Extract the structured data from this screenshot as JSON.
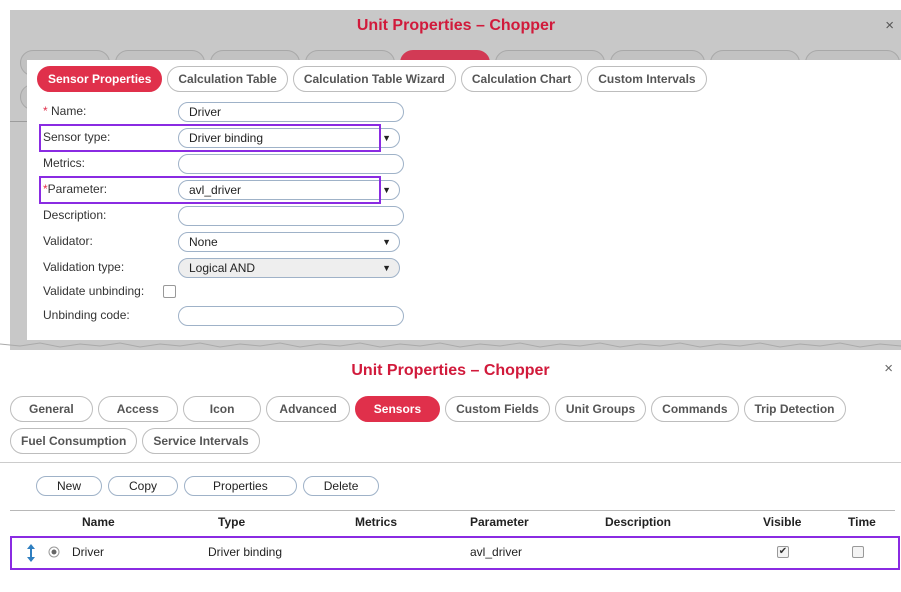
{
  "top_dialog": {
    "title": "Unit Properties – Chopper",
    "close_glyph": "×",
    "tabs": [
      "Sensor Properties",
      "Calculation Table",
      "Calculation Table Wizard",
      "Calculation Chart",
      "Custom Intervals"
    ],
    "form": {
      "name_label": "Name:",
      "name_value": "Driver",
      "sensor_type_label": "Sensor type:",
      "sensor_type_value": "Driver binding",
      "metrics_label": "Metrics:",
      "metrics_value": "",
      "parameter_label": "Parameter:",
      "parameter_value": "avl_driver",
      "description_label": "Description:",
      "description_value": "",
      "validator_label": "Validator:",
      "validator_value": "None",
      "validation_type_label": "Validation type:",
      "validation_type_value": "Logical AND",
      "validate_unbinding_label": "Validate unbinding:",
      "unbinding_code_label": "Unbinding code:",
      "unbinding_code_value": "",
      "required_mark": "*",
      "dropdown_caret": "▼"
    }
  },
  "bottom_dialog": {
    "title": "Unit Properties – Chopper",
    "close_glyph": "×",
    "tabs_row1": [
      "General",
      "Access",
      "Icon",
      "Advanced",
      "Sensors",
      "Custom Fields",
      "Unit Groups",
      "Commands",
      "Trip Detection"
    ],
    "tabs_row2": [
      "Fuel Consumption",
      "Service Intervals"
    ],
    "active_tab": "Sensors",
    "buttons": [
      "New",
      "Copy",
      "Properties",
      "Delete"
    ],
    "table": {
      "headers": [
        "Name",
        "Type",
        "Metrics",
        "Parameter",
        "Description",
        "Visible",
        "Time"
      ],
      "rows": [
        {
          "name": "Driver",
          "type": "Driver binding",
          "metrics": "",
          "parameter": "avl_driver",
          "description": "",
          "visible": true,
          "time": false
        }
      ]
    },
    "icons": {
      "drag": "drag-handle-icon",
      "radio": "radio-icon",
      "check": "✔"
    }
  },
  "colors": {
    "accent": "#e0304b",
    "title_red": "#d11a3b",
    "highlight": "#8a2be2"
  }
}
